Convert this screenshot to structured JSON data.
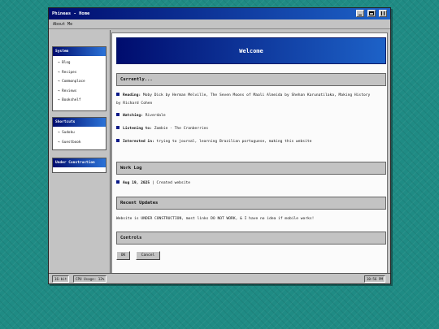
{
  "window": {
    "title": "Phineas - Home"
  },
  "menu": {
    "items": [
      "About Me"
    ]
  },
  "sidebar": {
    "panels": [
      {
        "title": "System",
        "items": [
          "→ Blog",
          "→ Recipes",
          "→ Commonplace",
          "→ Reviews",
          "→ Bookshelf"
        ]
      },
      {
        "title": "Shortcuts",
        "items": [
          "→ Sudoku",
          "→ Guestbook"
        ]
      },
      {
        "title": "Under Construction",
        "items": []
      }
    ]
  },
  "main": {
    "banner": "Welcome",
    "currently": {
      "heading": "Currently...",
      "rows": [
        {
          "label": "Reading:",
          "text": "Moby Dick by Herman Melville, The Seven Moons of Maali Almeida by Shehan Karunatilaka, Making History by Richard Cohen"
        },
        {
          "label": "Watching:",
          "text": "Riverdale"
        },
        {
          "label": "Listening to:",
          "text": "Zombie - The Cranberries"
        },
        {
          "label": "Interested in:",
          "text": "trying to journal, learning Brazilian portuguese, making this website"
        }
      ]
    },
    "worklog": {
      "heading": "Work Log",
      "entries": [
        {
          "date": "Aug 19, 2025",
          "text": "| Created website"
        }
      ]
    },
    "updates": {
      "heading": "Recent Updates",
      "text": "Website is UNDER CONSTRUCTION, most links DO NOT WORK, & I have no idea if mobile works!"
    },
    "controls": {
      "heading": "Controls",
      "ok_label": "OK",
      "cancel_label": "Cancel"
    }
  },
  "statusbar": {
    "color_depth": "16-bit",
    "cpu": "CPU Usage: 12%",
    "clock": "10:56 PM"
  },
  "colors": {
    "desktop": "#1f8b84",
    "titlebar_start": "#000c6e",
    "titlebar_end": "#1d62c8",
    "chrome": "#c3c3c3"
  }
}
